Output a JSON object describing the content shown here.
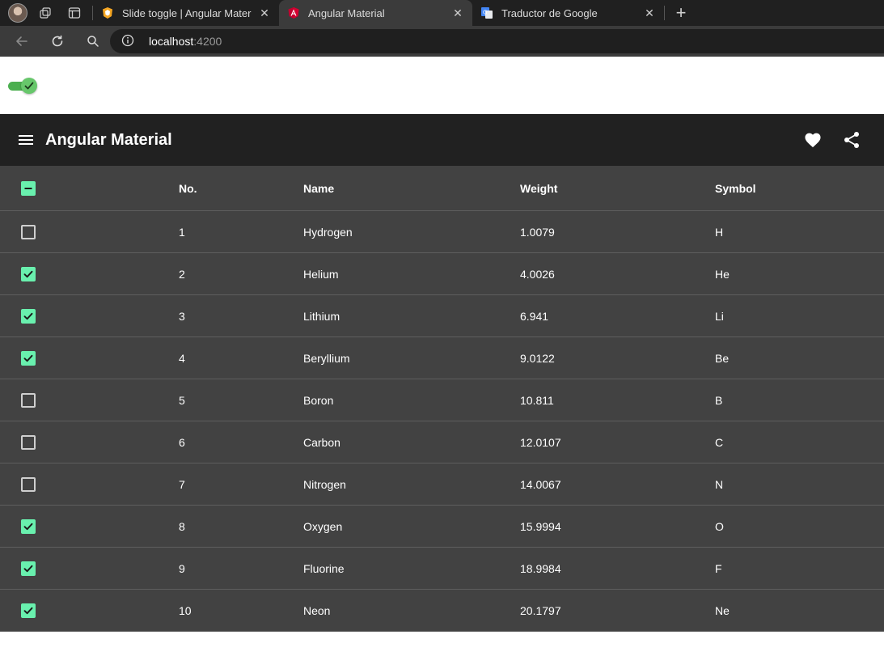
{
  "browser": {
    "tabs": [
      {
        "title": "Slide toggle | Angular Material",
        "active": false
      },
      {
        "title": "Angular Material",
        "active": true
      },
      {
        "title": "Traductor de Google",
        "active": false
      }
    ],
    "url_host": "localhost",
    "url_port": ":4200"
  },
  "page": {
    "toggle_checked": true,
    "toolbar_title": "Angular Material",
    "table": {
      "headers": {
        "no": "No.",
        "name": "Name",
        "weight": "Weight",
        "symbol": "Symbol"
      },
      "master_checkbox": "indeterminate",
      "rows": [
        {
          "no": "1",
          "name": "Hydrogen",
          "weight": "1.0079",
          "symbol": "H",
          "checked": false
        },
        {
          "no": "2",
          "name": "Helium",
          "weight": "4.0026",
          "symbol": "He",
          "checked": true
        },
        {
          "no": "3",
          "name": "Lithium",
          "weight": "6.941",
          "symbol": "Li",
          "checked": true
        },
        {
          "no": "4",
          "name": "Beryllium",
          "weight": "9.0122",
          "symbol": "Be",
          "checked": true
        },
        {
          "no": "5",
          "name": "Boron",
          "weight": "10.811",
          "symbol": "B",
          "checked": false
        },
        {
          "no": "6",
          "name": "Carbon",
          "weight": "12.0107",
          "symbol": "C",
          "checked": false
        },
        {
          "no": "7",
          "name": "Nitrogen",
          "weight": "14.0067",
          "symbol": "N",
          "checked": false
        },
        {
          "no": "8",
          "name": "Oxygen",
          "weight": "15.9994",
          "symbol": "O",
          "checked": true
        },
        {
          "no": "9",
          "name": "Fluorine",
          "weight": "18.9984",
          "symbol": "F",
          "checked": true
        },
        {
          "no": "10",
          "name": "Neon",
          "weight": "20.1797",
          "symbol": "Ne",
          "checked": true
        }
      ]
    }
  },
  "colors": {
    "accent": "#69f0ae",
    "toolbar_bg": "#212121",
    "table_bg": "#424242",
    "toggle_on": "#4caf50"
  },
  "icons": [
    "profile-avatar",
    "workspaces-icon",
    "tab-actions-icon",
    "menu-icon",
    "favorite-icon",
    "share-icon",
    "back-icon",
    "reload-icon",
    "search-icon",
    "info-icon"
  ]
}
